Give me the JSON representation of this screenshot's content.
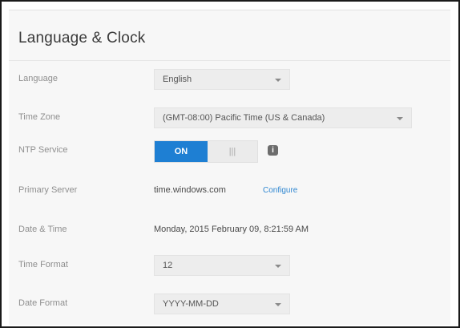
{
  "section": {
    "title": "Language & Clock"
  },
  "language": {
    "label": "Language",
    "value": "English"
  },
  "time_zone": {
    "label": "Time Zone",
    "value": "(GMT-08:00) Pacific Time (US & Canada)"
  },
  "ntp_service": {
    "label": "NTP Service",
    "on_label": "ON",
    "off_label": "|||",
    "state": "on",
    "info_icon": "info-icon",
    "info_glyph": "i"
  },
  "primary_server": {
    "label": "Primary Server",
    "value": "time.windows.com",
    "link": "Configure"
  },
  "date_time": {
    "label": "Date & Time",
    "value": "Monday, 2015 February 09, 8:21:59 AM"
  },
  "time_format": {
    "label": "Time Format",
    "value": "12"
  },
  "date_format": {
    "label": "Date Format",
    "value": "YYYY-MM-DD"
  },
  "colors": {
    "accent": "#1e7fd3",
    "link": "#2f87d1"
  }
}
